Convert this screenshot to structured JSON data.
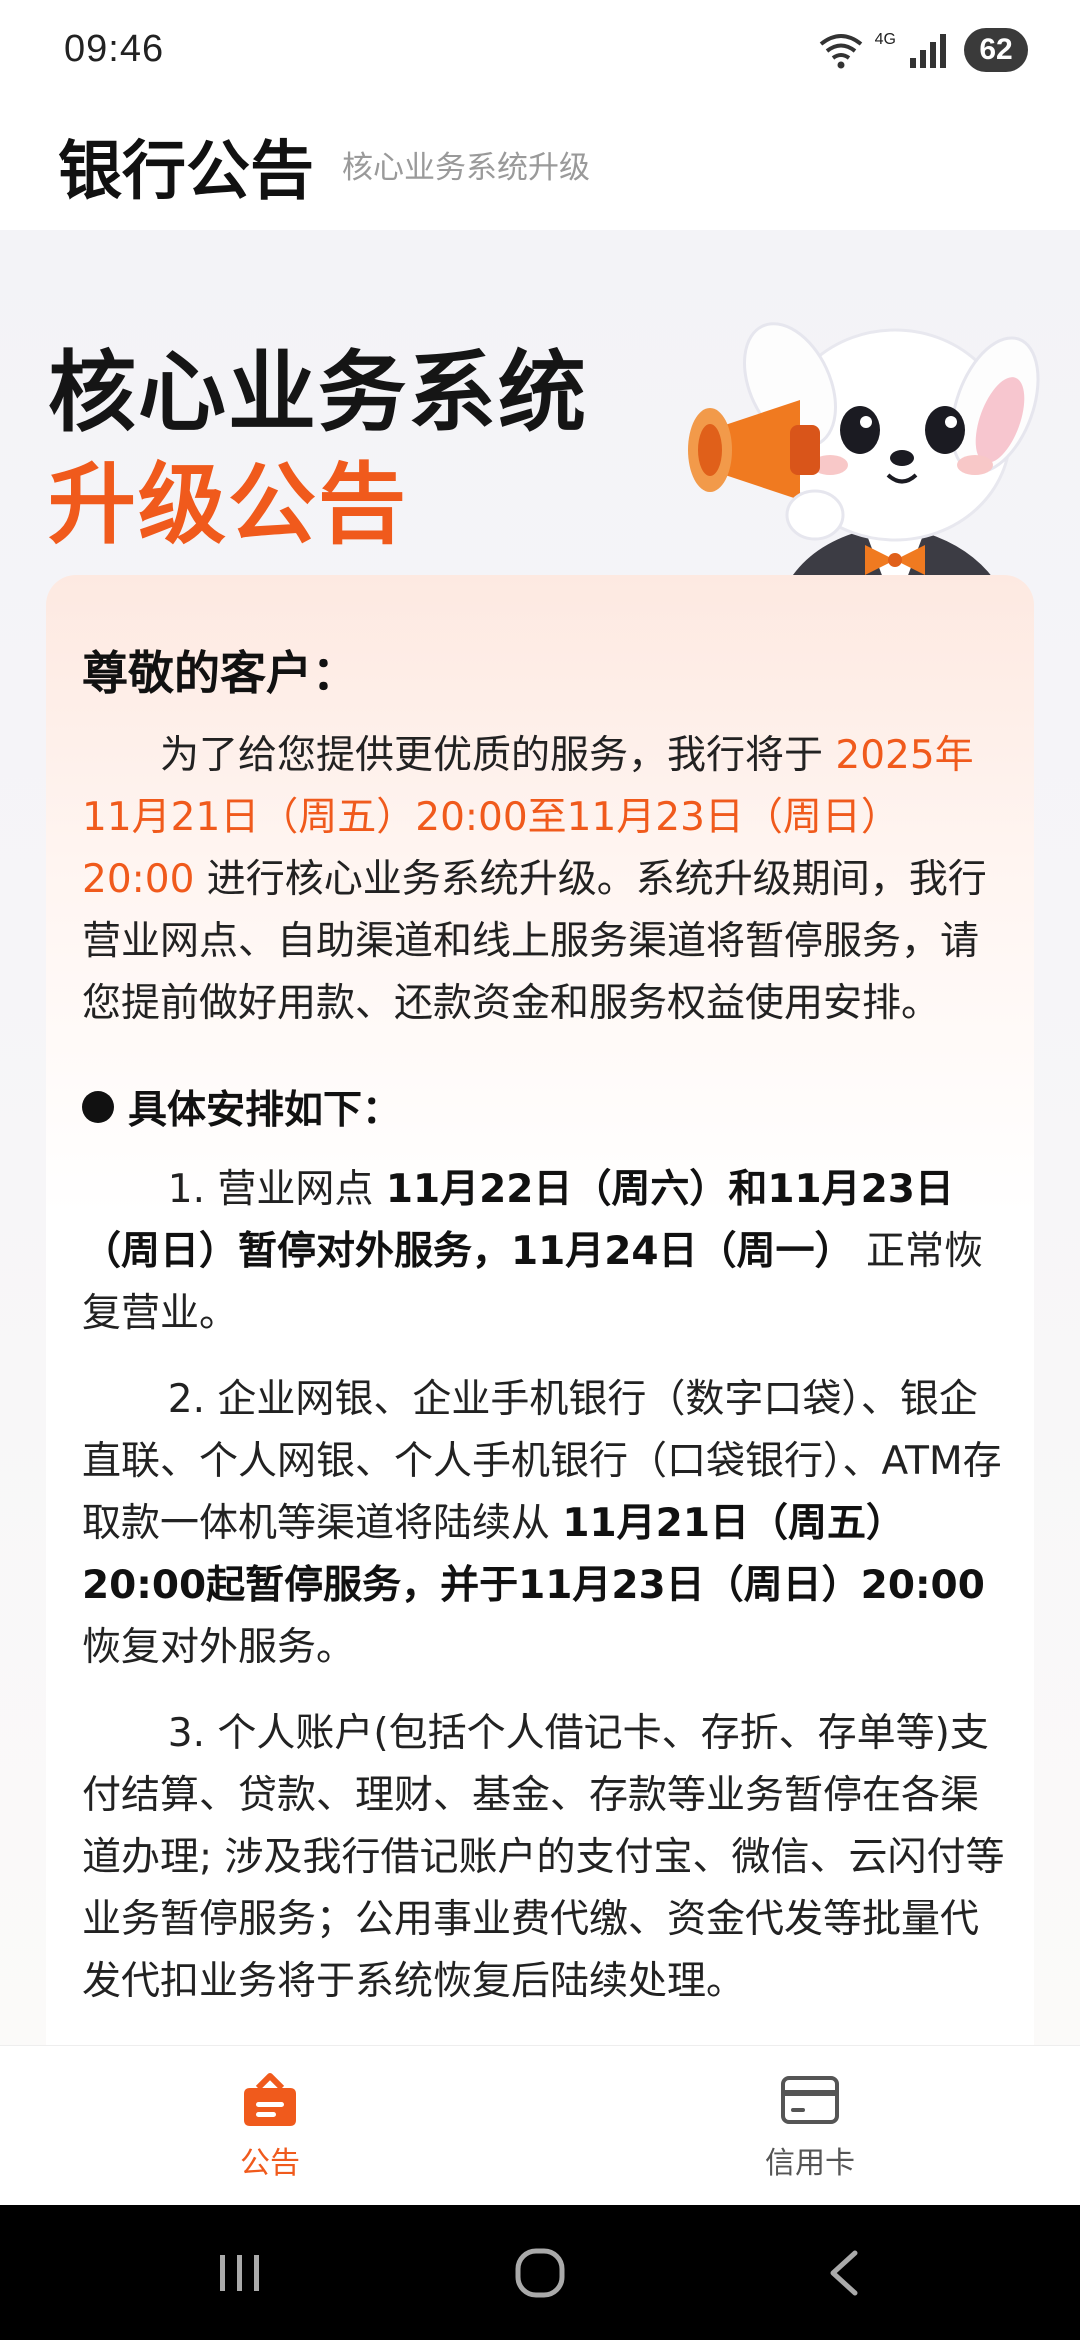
{
  "status_bar": {
    "time": "09:46",
    "network_label": "4G",
    "wifi_label": "6",
    "battery": "62"
  },
  "header": {
    "title": "银行公告",
    "subtitle": "核心业务系统升级"
  },
  "hero": {
    "title_line1": "核心业务系统",
    "title_line2": "升级公告"
  },
  "notice": {
    "greeting": "尊敬的客户：",
    "intro_before": "为了给您提供更优质的服务，我行将于 ",
    "intro_highlight": "2025年11月21日（周五）20:00至11月23日（周日）20:00",
    "intro_after": " 进行核心业务系统升级。系统升级期间，我行营业网点、自助渠道和线上服务渠道将暂停服务，请您提前做好用款、还款资金和服务权益使用安排。",
    "section_title": "具体安排如下：",
    "items": [
      {
        "prefix": "1. 营业网点 ",
        "bold": "11月22日（周六）和11月23日（周日）暂停对外服务，11月24日（周一）",
        "suffix": " 正常恢复营业。"
      },
      {
        "prefix": "2. 企业网银、企业手机银行（数字口袋）、银企直联、个人网银、个人手机银行（口袋银行）、ATM存取款一体机等渠道将陆续从 ",
        "bold": "11月21日（周五）20:00起暂停服务，并于11月23日（周日）20:00",
        "suffix": " 恢复对外服务。"
      },
      {
        "prefix": "3. 个人账户(包括个人借记卡、存折、存单等)支付结算、贷款、理财、基金、存款等业务暂停在各渠道办理; 涉及我行借记账户的支付宝、微信、云闪付等业务暂停服务；公用事业费代缴、资金代发等批量代发代扣业务将于系统恢复后陆续处理。",
        "bold": "",
        "suffix": ""
      }
    ]
  },
  "bottom_nav": {
    "items": [
      {
        "label": "公告",
        "icon": "announcement-icon",
        "active": true
      },
      {
        "label": "信用卡",
        "icon": "credit-card-icon",
        "active": false
      }
    ]
  },
  "colors": {
    "accent": "#f05a1c",
    "text": "#111111",
    "subtitle": "#9a9a9a"
  }
}
